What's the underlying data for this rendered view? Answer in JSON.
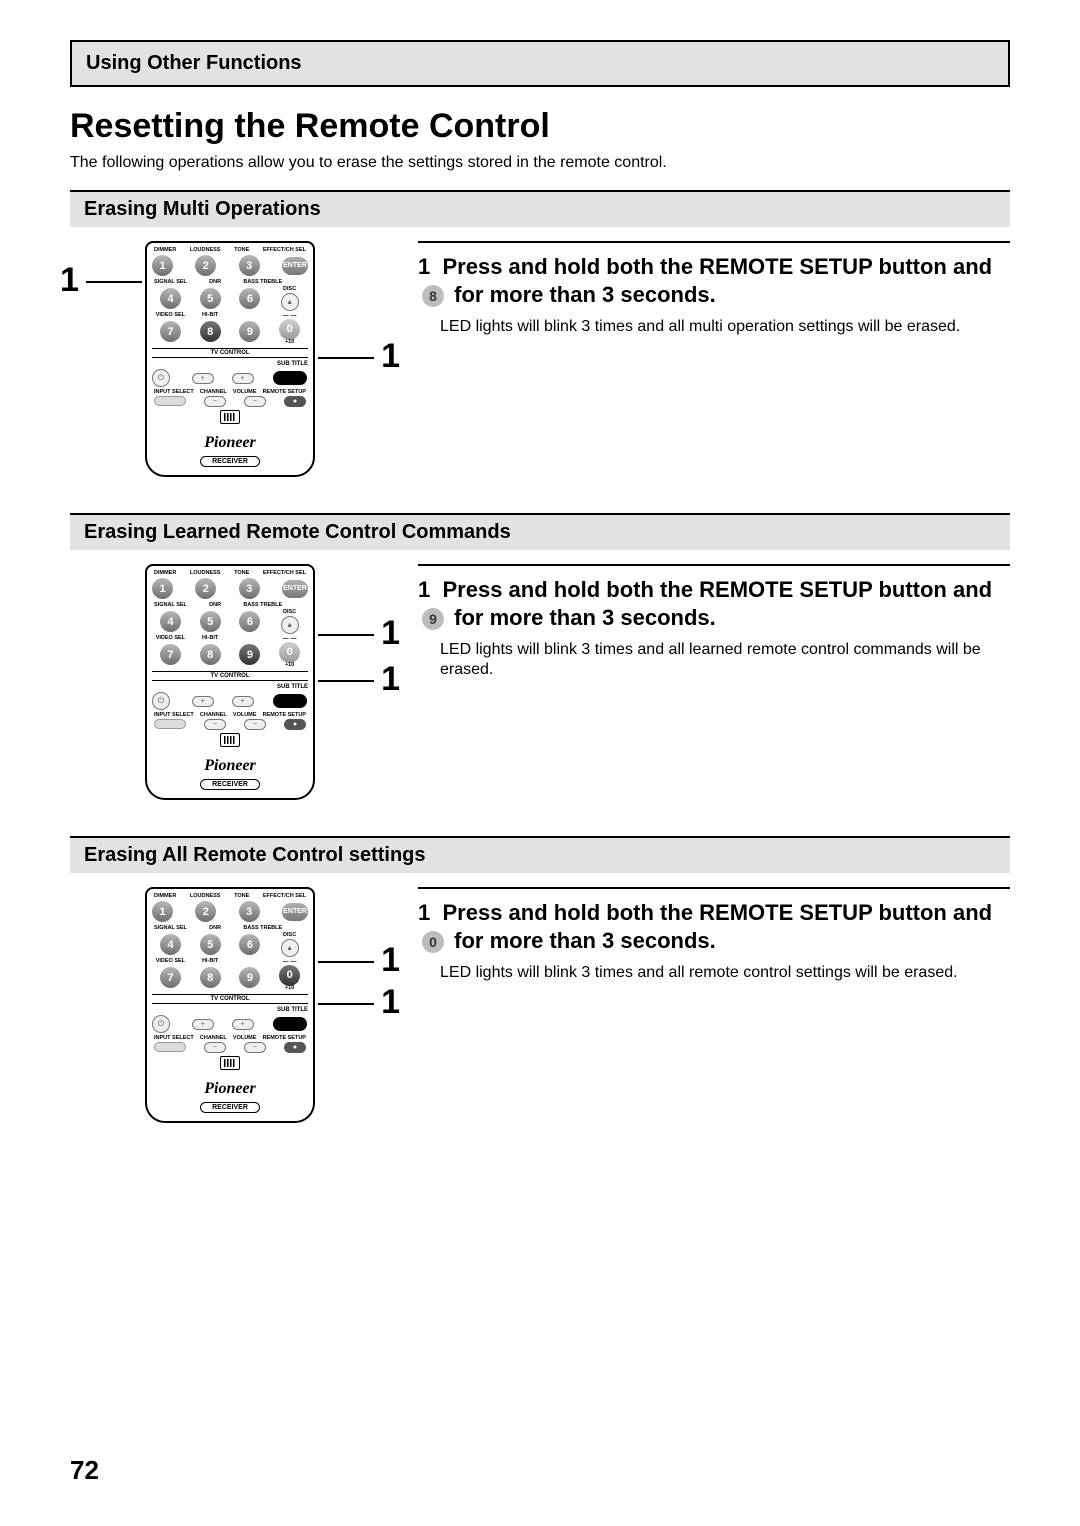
{
  "header": {
    "chapter": "Using Other Functions"
  },
  "title": "Resetting the Remote Control",
  "intro": "The following operations allow you to erase the settings stored in the remote control.",
  "page_number": "72",
  "remote": {
    "top_labels": [
      "DIMMER",
      "LOUDNESS",
      "TONE",
      "EFFECT/CH SEL"
    ],
    "enter": "ENTER",
    "mid_labels": [
      "SIGNAL SEL",
      "DNR",
      "BASS TREBLE"
    ],
    "disc": "DISC",
    "video_sel": "VIDEO SEL",
    "hibit": "HI-BIT",
    "plus10": "+10",
    "tv_control": "TV CONTROL",
    "sub_title": "SUB TITLE",
    "bot_labels": [
      "INPUT\nSELECT",
      "CHANNEL",
      "VOLUME",
      "REMOTE\nSETUP"
    ],
    "brand": "Pioneer",
    "receiver": "RECEIVER",
    "numbers": [
      "1",
      "2",
      "3",
      "4",
      "5",
      "6",
      "7",
      "8",
      "9",
      "0"
    ]
  },
  "sections": [
    {
      "heading": "Erasing Multi Operations",
      "highlight_num": "8",
      "step_num": "1",
      "step_title_a": "Press and hold both the REMOTE SETUP button and ",
      "step_badge": "8",
      "step_title_b": " for more than 3 seconds.",
      "step_desc": "LED lights will blink 3 times and all multi operation settings will be erased.",
      "callouts": {
        "left": "1",
        "right_top": "1"
      }
    },
    {
      "heading": "Erasing Learned Remote Control Commands",
      "highlight_num": "9",
      "step_num": "1",
      "step_title_a": "Press and hold both the REMOTE SETUP button and ",
      "step_badge": "9",
      "step_title_b": " for more than 3 seconds.",
      "step_desc": "LED lights will blink 3 times and all learned remote control commands will be erased.",
      "callouts": {
        "right_top": "1",
        "right_bot": "1"
      }
    },
    {
      "heading": "Erasing All Remote Control settings",
      "highlight_num": "0",
      "step_num": "1",
      "step_title_a": "Press and hold both the REMOTE SETUP button and ",
      "step_badge": "0",
      "step_title_b": " for more than 3 seconds.",
      "step_desc": "LED lights will blink 3 times and all remote control settings will be erased.",
      "callouts": {
        "right_top": "1",
        "right_bot": "1"
      }
    }
  ]
}
